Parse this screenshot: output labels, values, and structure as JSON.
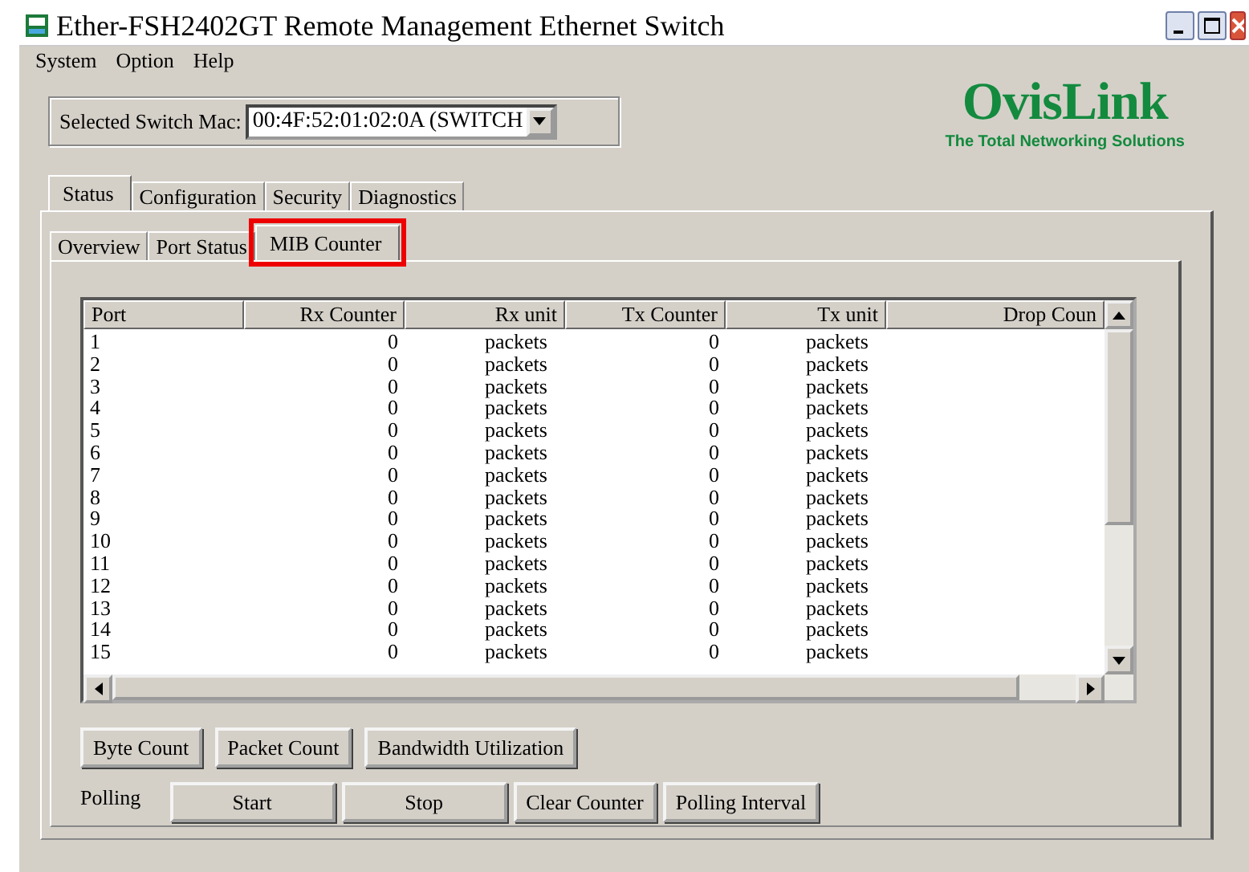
{
  "window": {
    "title": "Ether-FSH2402GT Remote Management Ethernet Switch"
  },
  "menu": [
    "System",
    "Option",
    "Help"
  ],
  "switch_select": {
    "label": "Selected Switch Mac:",
    "value": "00:4F:52:01:02:0A (SWITCH"
  },
  "logo": {
    "name": "OvisLink",
    "tagline": "The Total Networking Solutions"
  },
  "tabs": [
    {
      "label": "Status",
      "selected": true
    },
    {
      "label": "Configuration",
      "selected": false
    },
    {
      "label": "Security",
      "selected": false
    },
    {
      "label": "Diagnostics",
      "selected": false
    }
  ],
  "subtabs": [
    {
      "label": "Overview",
      "selected": false,
      "highlighted": false
    },
    {
      "label": "Port Status",
      "selected": false,
      "highlighted": false
    },
    {
      "label": "MIB Counter",
      "selected": true,
      "highlighted": true
    }
  ],
  "table": {
    "columns": [
      "Port",
      "Rx Counter",
      "Rx unit",
      "Tx Counter",
      "Tx unit",
      "Drop Coun"
    ],
    "rows": [
      [
        "1",
        "0",
        "packets",
        "0",
        "packets"
      ],
      [
        "2",
        "0",
        "packets",
        "0",
        "packets"
      ],
      [
        "3",
        "0",
        "packets",
        "0",
        "packets"
      ],
      [
        "4",
        "0",
        "packets",
        "0",
        "packets"
      ],
      [
        "5",
        "0",
        "packets",
        "0",
        "packets"
      ],
      [
        "6",
        "0",
        "packets",
        "0",
        "packets"
      ],
      [
        "7",
        "0",
        "packets",
        "0",
        "packets"
      ],
      [
        "8",
        "0",
        "packets",
        "0",
        "packets"
      ],
      [
        "9",
        "0",
        "packets",
        "0",
        "packets"
      ],
      [
        "10",
        "0",
        "packets",
        "0",
        "packets"
      ],
      [
        "11",
        "0",
        "packets",
        "0",
        "packets"
      ],
      [
        "12",
        "0",
        "packets",
        "0",
        "packets"
      ],
      [
        "13",
        "0",
        "packets",
        "0",
        "packets"
      ],
      [
        "14",
        "0",
        "packets",
        "0",
        "packets"
      ],
      [
        "15",
        "0",
        "packets",
        "0",
        "packets"
      ]
    ]
  },
  "count_buttons": [
    "Byte Count",
    "Packet Count",
    "Bandwidth Utilization"
  ],
  "polling": {
    "label": "Polling",
    "buttons": [
      "Start",
      "Stop",
      "Clear Counter",
      "Polling Interval"
    ]
  }
}
